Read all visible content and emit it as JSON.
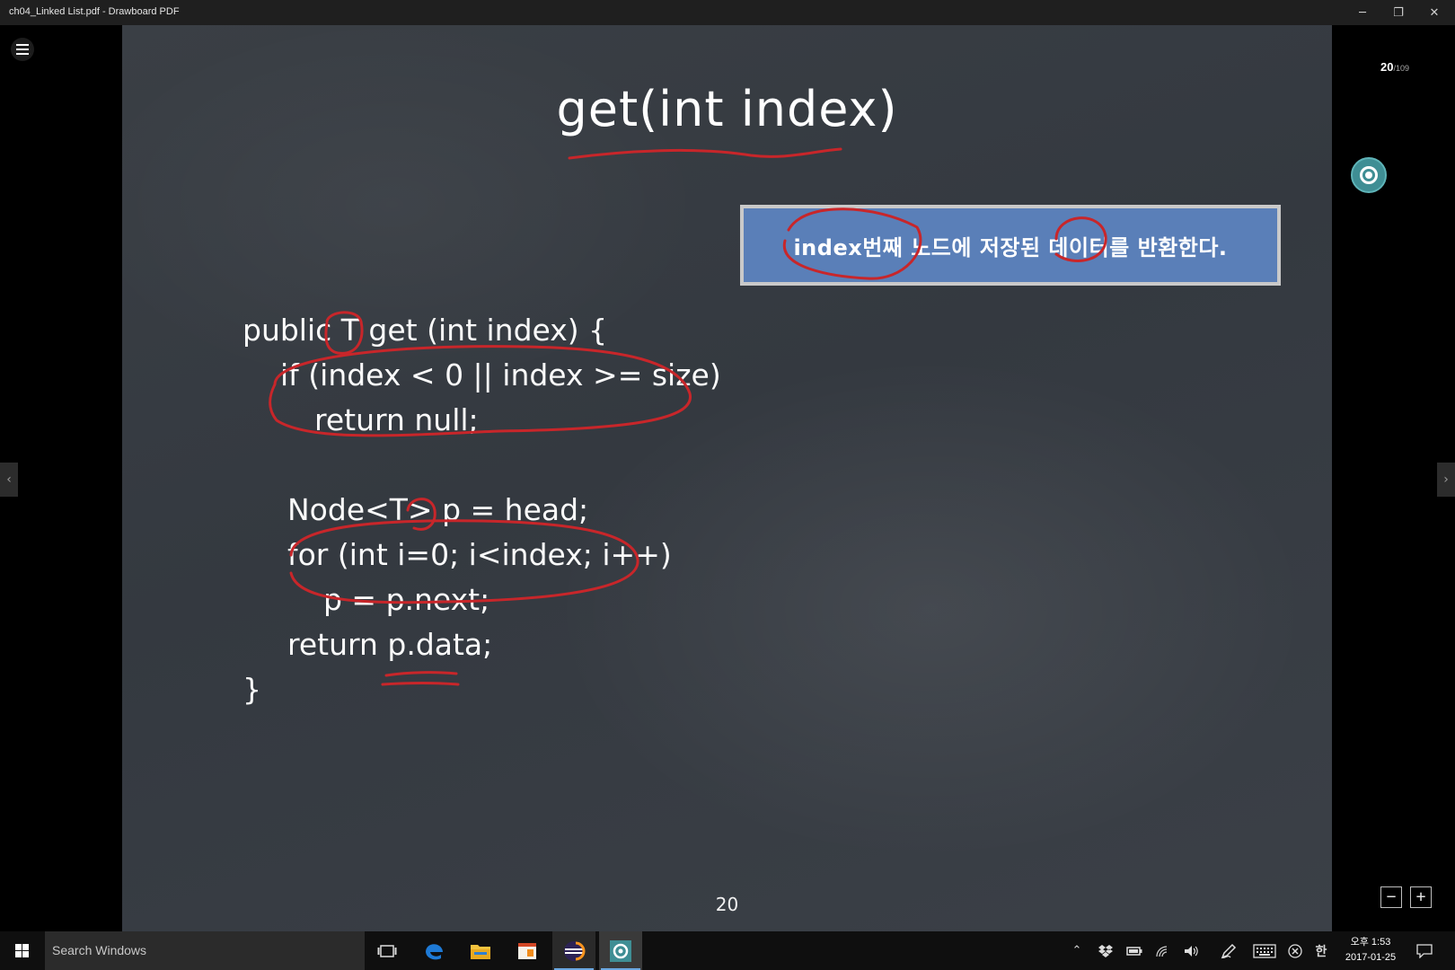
{
  "window": {
    "title": "ch04_Linked List.pdf - Drawboard PDF",
    "minimize": "─",
    "restore": "❐",
    "close": "✕"
  },
  "viewer": {
    "current_page": "20",
    "total_pages": "/109",
    "prev_arrow": "‹",
    "next_arrow": "›",
    "zoom_out": "−",
    "zoom_in": "+"
  },
  "slide": {
    "title": "get(int index)",
    "note": "index번째 노드에 저장된 데이터를 반환한다.",
    "code_lines": [
      "public T get (int index) {",
      "if (index < 0 || index >= size)",
      "return null;",
      "Node<T> p = head;",
      "for (int i=0; i<index; i++)",
      "p = p.next;",
      "return p.data;",
      "}"
    ],
    "page_number": "20"
  },
  "annotations": {
    "ink_color": "#c8262a"
  },
  "taskbar": {
    "search_placeholder": "Search Windows",
    "clock_time": "오후 1:53",
    "clock_date": "2017-01-25",
    "ime": "한"
  }
}
